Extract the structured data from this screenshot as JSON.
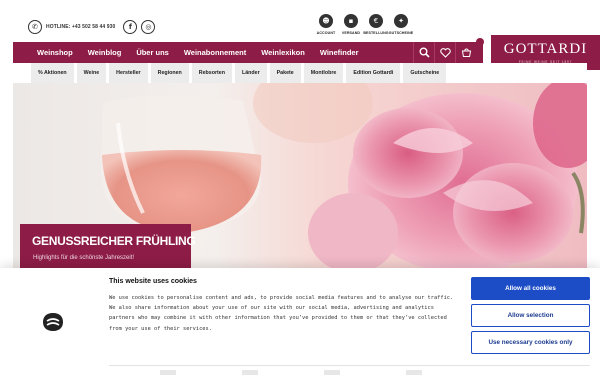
{
  "topbar": {
    "hotline_label": "HOTLINE: +43 502 58 44 930",
    "phone_icon": "phone-icon",
    "social": [
      {
        "icon": "facebook-icon",
        "glyph": "f"
      },
      {
        "icon": "instagram-icon",
        "glyph": "◎"
      }
    ],
    "services": [
      {
        "label": "ACCOUNT",
        "icon": "account-icon",
        "glyph": "☻"
      },
      {
        "label": "VERSAND",
        "icon": "shipping-icon",
        "glyph": "▪"
      },
      {
        "label": "BESTELLUNG",
        "icon": "euro-icon",
        "glyph": "€"
      },
      {
        "label": "GUTSCHEINE",
        "icon": "gift-icon",
        "glyph": "✦"
      }
    ]
  },
  "mainnav": {
    "items": [
      "Weinshop",
      "Weinblog",
      "Über uns",
      "Weinabonnement",
      "Weinlexikon",
      "Winefinder"
    ],
    "icons": [
      {
        "name": "search-icon",
        "glyph": "⚲"
      },
      {
        "name": "heart-icon",
        "glyph": "♡"
      },
      {
        "name": "cart-icon",
        "glyph": "⊔"
      }
    ]
  },
  "logo": {
    "name": "GOTTARDI",
    "tagline": "FEINE WEINE SEIT 1897"
  },
  "subnav": {
    "items": [
      "% Aktionen",
      "Weine",
      "Hersteller",
      "Regionen",
      "Rebsorten",
      "Länder",
      "Pakete",
      "Montlobre",
      "Edition Gottardi",
      "Gutscheine"
    ]
  },
  "hero": {
    "headline": "GENUSSREICHER FRÜHLING",
    "subline": "Highlights für die schönste Jahreszeit!"
  },
  "cookie": {
    "title": "This website uses cookies",
    "text": "We use cookies to personalise content and ads, to provide social media features and to analyse our traffic. We also share information about your use of our site with our social media, advertising and analytics partners who may combine it with other information that you’ve provided to them or that they’ve collected from your use of their services.",
    "buttons": {
      "allow_all": "Allow all cookies",
      "allow_selection": "Allow selection",
      "necessary_only": "Use necessary cookies only"
    }
  },
  "colors": {
    "brand": "#8d1c46",
    "cookie_button": "#1c4cc6"
  }
}
